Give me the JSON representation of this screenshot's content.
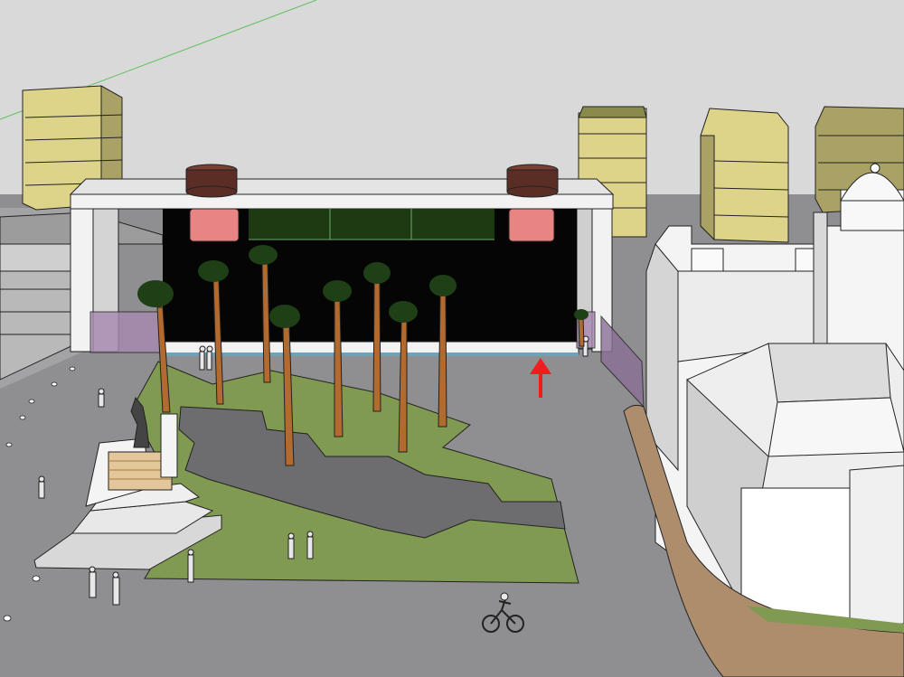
{
  "scene": {
    "colors": {
      "sky": "#d9d9d9",
      "ground": "#8f8f91",
      "plaza_lawn": "#809a52",
      "paved_path": "#6d6d6f",
      "screen_wall": "#050505",
      "frame": "#f2f2f2",
      "tower": "#ddd48a",
      "tower_dark": "#aaa165",
      "chimney": "#5b2e25",
      "lantern": "#e98484",
      "palm_trunk": "#b26a2f",
      "palm_leaf": "#1f3f16",
      "promenade": "#ae8d6d",
      "glass_tint": "#a889b1",
      "arrow": "#ee1e1e",
      "outline": "#222222"
    },
    "palm_tree_count": 9,
    "pedestrian_count": 10,
    "cyclist_count": 1,
    "icons": [
      "arrow-up-icon",
      "statue-icon",
      "cyclist-icon",
      "pedestrian-icon",
      "palm-tree-icon",
      "dome-icon"
    ]
  }
}
